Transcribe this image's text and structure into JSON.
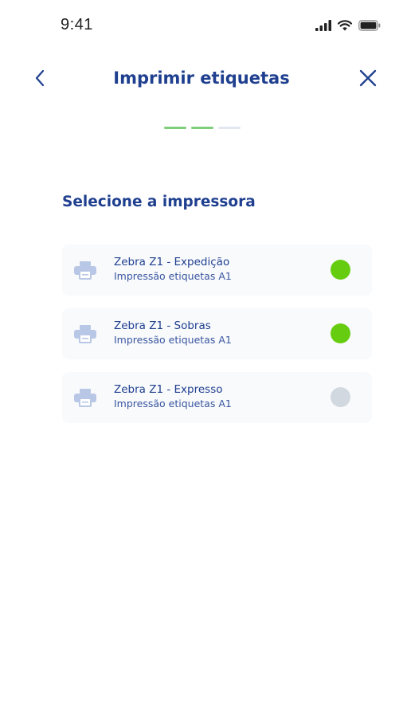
{
  "status_bar": {
    "time": "9:41",
    "icons": [
      "signal-icon",
      "wifi-icon",
      "battery-icon"
    ]
  },
  "header": {
    "title": "Imprimir etiquetas",
    "back_icon": "chevron-left-icon",
    "close_icon": "close-icon"
  },
  "stepper": {
    "total_steps": 3,
    "completed_steps": 2,
    "done_color": "#7fce79",
    "pending_color": "#e3e7f2"
  },
  "main": {
    "section_title": "Selecione a impressora",
    "printers": [
      {
        "name": "Zebra Z1 - Expedição",
        "description": "Impressão etiquetas A1",
        "status": "online",
        "status_color": "#66cc10"
      },
      {
        "name": "Zebra Z1 - Sobras",
        "description": "Impressão etiquetas A1",
        "status": "online",
        "status_color": "#66cc10"
      },
      {
        "name": "Zebra Z1 - Expresso",
        "description": "Impressão etiquetas A1",
        "status": "offline",
        "status_color": "#d2d8df"
      }
    ]
  },
  "colors": {
    "primary": "#1f3f8f",
    "card_background": "#f8fafc",
    "printer_icon": "#b9c7e6"
  }
}
